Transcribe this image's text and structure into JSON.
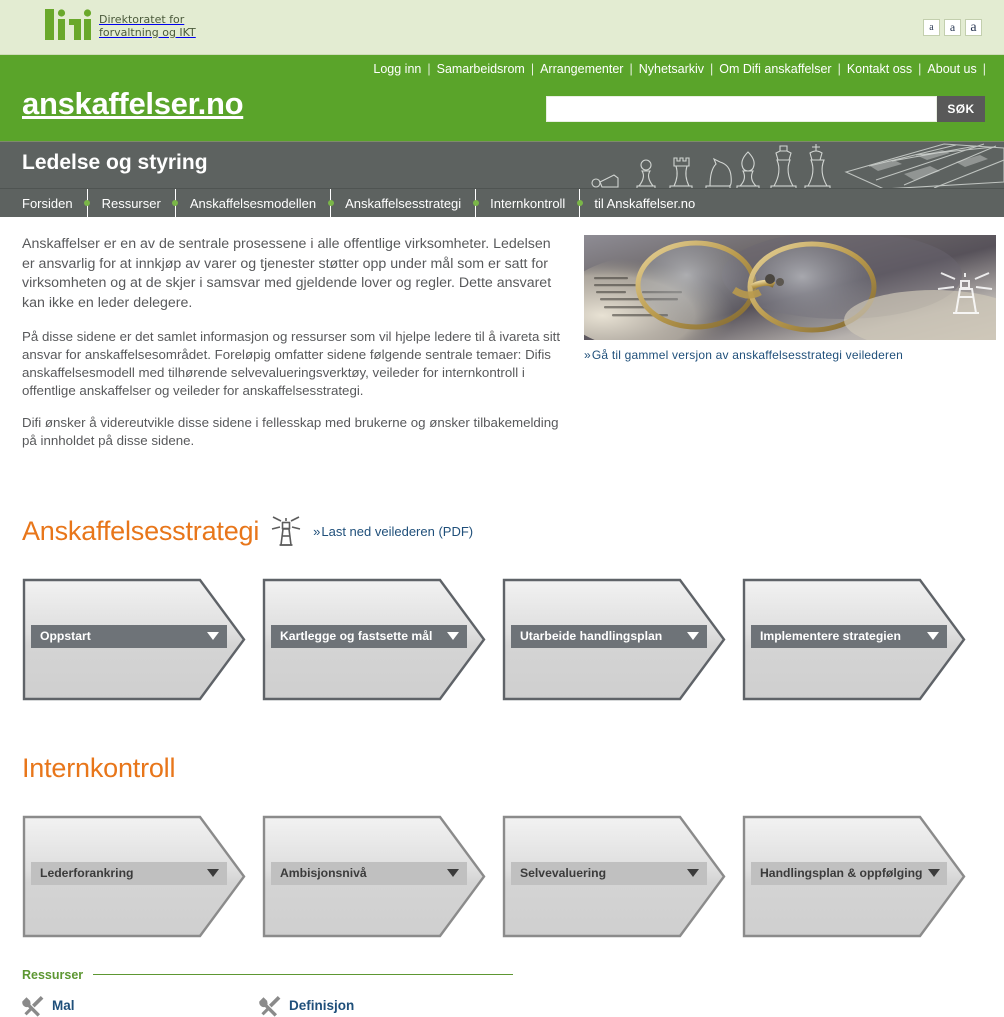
{
  "header": {
    "logo": {
      "wordmark": "difi",
      "tagline_line1": "Direktoratet for",
      "tagline_line2": "forvaltning og IKT",
      "green": "#6aa82b",
      "dark": "#55595b"
    },
    "text_size_buttons": [
      {
        "label": "a",
        "name": "text-size-small"
      },
      {
        "label": "a",
        "name": "text-size-medium"
      },
      {
        "label": "a",
        "name": "text-size-large"
      }
    ],
    "utility_nav": [
      "Logg inn",
      "Samarbeidsrom",
      "Arrangementer",
      "Nyhetsarkiv",
      "Om Difi anskaffelser",
      "Kontakt oss",
      "About us"
    ],
    "separator": "|",
    "site_title": "anskaffelser.no",
    "search": {
      "value": "",
      "placeholder": "",
      "button_label": "SØK"
    },
    "hero_title": "Ledelse og styring",
    "main_nav": [
      "Forsiden",
      "Ressurser",
      "Anskaffelsesmodellen",
      "Anskaffelsesstrategi",
      "Internkontroll",
      "til Anskaffelser.no"
    ]
  },
  "intro": {
    "paragraphs": [
      "Anskaffelser er en av de sentrale prosessene i alle offentlige virksomheter. Ledelsen er ansvarlig for at innkjøp av varer og tjenester støtter opp under mål som er satt for virksomheten og at de skjer i samsvar med gjeldende lover og regler. Dette ansvaret kan ikke en leder delegere.",
      "På disse sidene er det samlet informasjon og ressurser som vil hjelpe ledere til å ivareta sitt ansvar for anskaffelsesområdet. Foreløpig omfatter sidene følgende sentrale temaer: Difis anskaffelsesmodell med tilhørende selvevalueringsverktøy, veileder for internkontroll i offentlige anskaffelser og veileder for anskaffelsesstrategi.",
      "Difi ønsker å videreutvikle disse sidene i fellesskap med brukerne og ønsker tilbakemelding på innholdet på disse sidene."
    ],
    "photo_alt": "briller-pa-bok-bilde",
    "photo_link": "Gå til gammel versjon av anskaffelsesstrategi veilederen",
    "chevron_glyph": "»"
  },
  "strategy_section": {
    "title": "Anskaffelsesstrategi",
    "title_color": "#e8761a",
    "download_link": "Last ned veilederen (PDF)",
    "chevron_glyph": "»",
    "steps": [
      {
        "label": "Oppstart",
        "style": "dark"
      },
      {
        "label": "Kartlegge og fastsette mål",
        "style": "dark"
      },
      {
        "label": "Utarbeide handlingsplan",
        "style": "dark"
      },
      {
        "label": "Implementere strategien",
        "style": "dark"
      }
    ]
  },
  "internal_control_section": {
    "title": "Internkontroll",
    "title_color": "#e8761a",
    "steps": [
      {
        "label": "Lederforankring",
        "style": "light"
      },
      {
        "label": "Ambisjonsnivå",
        "style": "light"
      },
      {
        "label": "Selvevaluering",
        "style": "light"
      },
      {
        "label": "Handlingsplan & oppfølging",
        "style": "light"
      }
    ]
  },
  "resources": {
    "title": "Ressurser",
    "title_color": "#5d9732",
    "links": [
      {
        "label": "Mal",
        "icon": "tools-icon"
      },
      {
        "label": "Definisjon",
        "icon": "tools-icon"
      }
    ]
  }
}
